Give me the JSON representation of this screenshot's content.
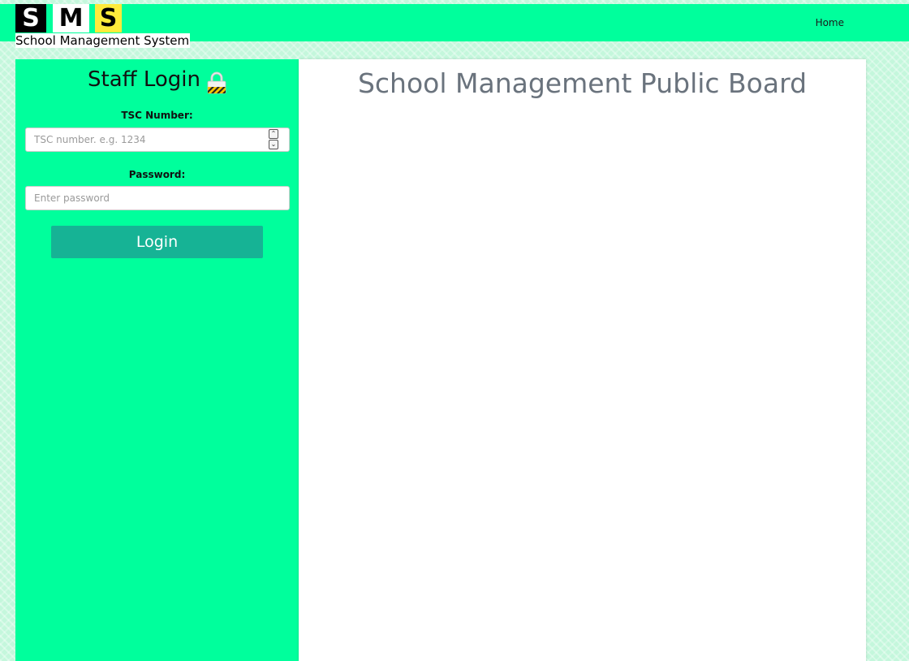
{
  "header": {
    "logo_letters": [
      "S",
      "M",
      "S"
    ],
    "logo_subtitle": "School Management System",
    "nav_home": "Home"
  },
  "login": {
    "title": "Staff Login",
    "tsc_label": "TSC Number:",
    "tsc_placeholder": "TSC number. e.g. 1234",
    "password_label": "Password:",
    "password_placeholder": "Enter password",
    "button_label": "Login",
    "icon": "lock-icon"
  },
  "board": {
    "title": "School Management Public Board"
  },
  "colors": {
    "accent": "#00ff9c",
    "button": "#16b395",
    "board_title": "#6a737d",
    "logo_yellow": "#ffeb3b"
  }
}
